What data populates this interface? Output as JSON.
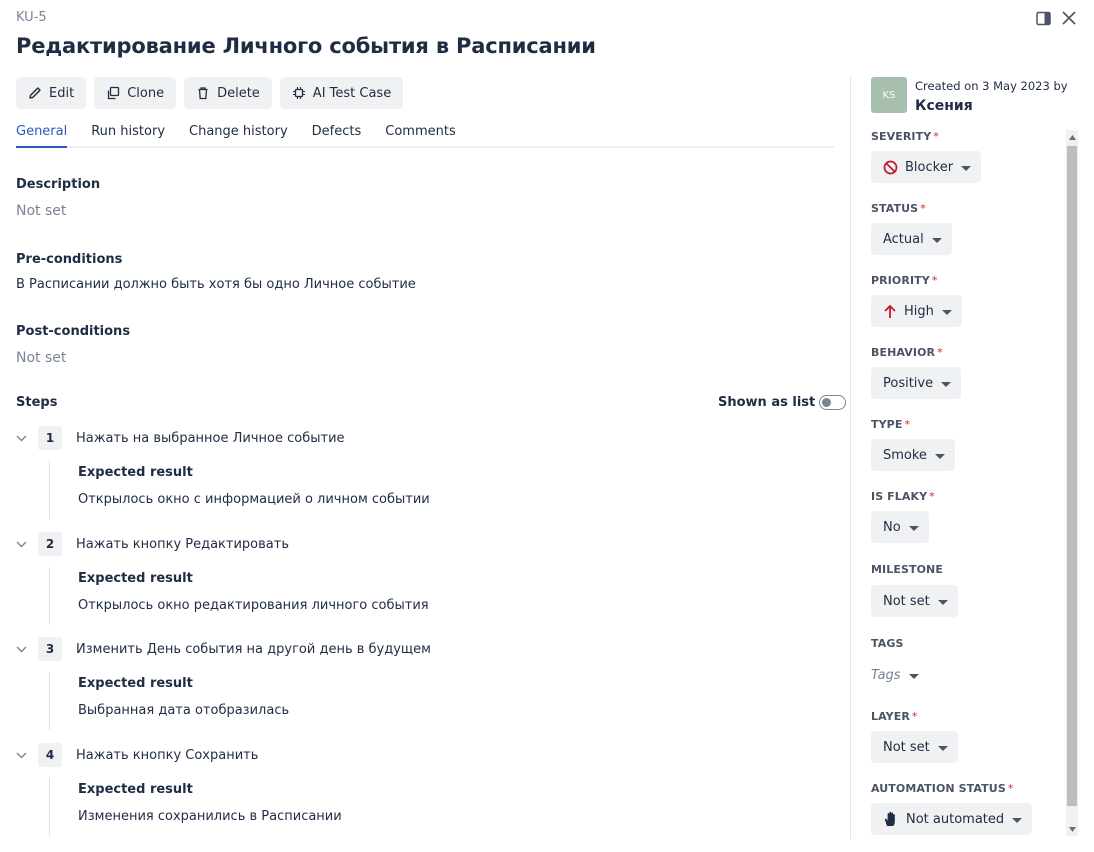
{
  "header": {
    "case_id": "KU-5",
    "title": "Редактирование Личного события в Расписании"
  },
  "toolbar": {
    "edit": "Edit",
    "clone": "Clone",
    "delete": "Delete",
    "ai_test_case": "AI Test Case"
  },
  "tabs": [
    "General",
    "Run history",
    "Change history",
    "Defects",
    "Comments"
  ],
  "general": {
    "description_label": "Description",
    "description_value": "Not set",
    "preconditions_label": "Pre-conditions",
    "preconditions_value": "В Расписании должно быть хотя бы одно Личное событие",
    "postconditions_label": "Post-conditions",
    "postconditions_value": "Not set",
    "steps_label": "Steps",
    "shown_as_list": "Shown as list",
    "shown_as_list_on": false
  },
  "steps": [
    {
      "num": "1",
      "action": "Нажать на выбранное Личное событие",
      "expected_label": "Expected result",
      "expected": "Открылось окно с информацией о личном событии"
    },
    {
      "num": "2",
      "action": "Нажать кнопку Редактировать",
      "expected_label": "Expected result",
      "expected": "Открылось окно редактирования личного события"
    },
    {
      "num": "3",
      "action": "Изменить День события на другой день в будущем",
      "expected_label": "Expected result",
      "expected": "Выбранная дата отобразилась"
    },
    {
      "num": "4",
      "action": "Нажать кнопку Сохранить",
      "expected_label": "Expected result",
      "expected": "Изменения сохранились в Расписании"
    }
  ],
  "sidebar": {
    "avatar_initials": "KS",
    "created": "Created on 3 May 2023 by",
    "author": "Ксения",
    "fields": {
      "severity": {
        "label": "SEVERITY",
        "value": "Blocker",
        "icon": "blocker-icon"
      },
      "status": {
        "label": "STATUS",
        "value": "Actual"
      },
      "priority": {
        "label": "PRIORITY",
        "value": "High",
        "icon": "arrow-up-icon"
      },
      "behavior": {
        "label": "BEHAVIOR",
        "value": "Positive"
      },
      "type": {
        "label": "TYPE",
        "value": "Smoke"
      },
      "is_flaky": {
        "label": "IS FLAKY",
        "value": "No"
      },
      "milestone": {
        "label": "MILESTONE",
        "value": "Not set"
      },
      "tags": {
        "label": "TAGS",
        "value": "Tags"
      },
      "layer": {
        "label": "LAYER",
        "value": "Not set"
      },
      "automation_status": {
        "label": "AUTOMATION STATUS",
        "value": "Not automated",
        "icon": "hand-icon"
      }
    },
    "required_mark": "*"
  },
  "colors": {
    "accent": "#2858b8",
    "danger": "#c4182d",
    "button_bg": "#f0f1f3",
    "text": "#1f2c43"
  }
}
